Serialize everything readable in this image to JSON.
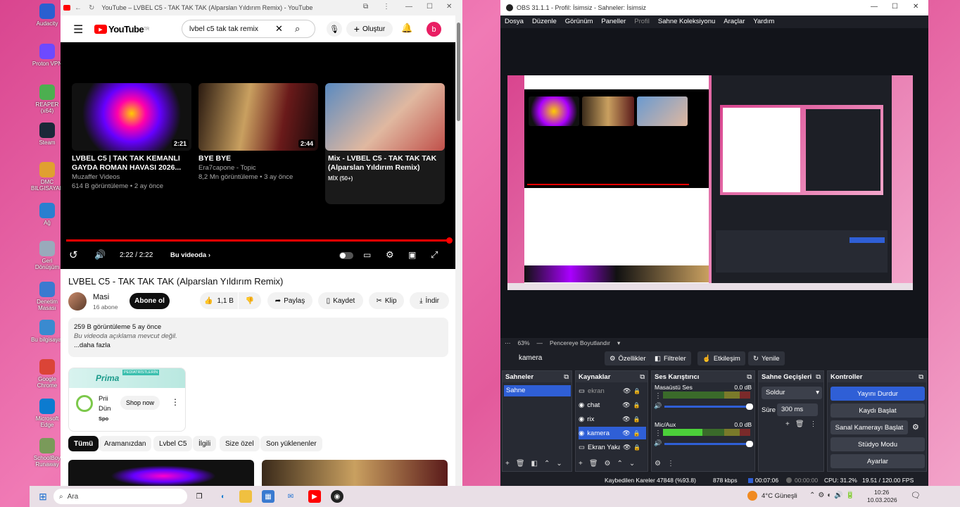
{
  "desktop": {
    "icons": [
      {
        "label": "Audacity",
        "color": "#2a5fd0"
      },
      {
        "label": "Proton VPN",
        "color": "#6d4aff"
      },
      {
        "label": "REAPER (x64)",
        "color": "#4caf50"
      },
      {
        "label": "Steam",
        "color": "#1b2838"
      },
      {
        "label": "DMC BILGISAYAR",
        "color": "#e0a030"
      },
      {
        "label": "Ağ",
        "color": "#2a7fd0"
      },
      {
        "label": "Geri Dönüşüm",
        "color": "#9ab"
      },
      {
        "label": "Denetim Masası",
        "color": "#3a7ad0"
      },
      {
        "label": "Bu bilgisayar",
        "color": "#3a8ad0"
      },
      {
        "label": "Google Chrome",
        "color": "#db4437"
      },
      {
        "label": "Microsoft Edge",
        "color": "#0c7bd0"
      },
      {
        "label": "SchoolBoy Runaway",
        "color": "#7a9a5a"
      }
    ]
  },
  "browser": {
    "tab_title": "YouTube – LVBEL C5 - TAK TAK TAK (Alparslan Yıldırım Remix) - YouTube",
    "logo": "YouTube",
    "logo_sup": "TR",
    "search_value": "lvbel c5 tak tak remix",
    "create_label": "Oluştur",
    "avatar_letter": "b",
    "cards": [
      {
        "title": "LVBEL C5 | TAK TAK KEMANLI GAYDA ROMAN HAVASI 2026...",
        "channel": "Muzaffer Videos",
        "meta": "614 B görüntüleme • 2 ay önce",
        "duration": "2:21"
      },
      {
        "title": "BYE BYE",
        "channel": "Era7capone - Topic",
        "meta": "8,2 Mn görüntüleme • 3 ay önce",
        "duration": "2:44"
      },
      {
        "title": "Mix - LVBEL C5 - TAK TAK TAK (Alparslan Yıldırım Remix)",
        "channel": "",
        "meta": "MİX (50+)",
        "duration": ""
      }
    ],
    "player": {
      "time": "2:22 / 2:22",
      "in_video": "Bu videoda",
      "progress": 1.0
    },
    "video_title": "LVBEL C5 - TAK TAK TAK (Alparslan Yıldırım Remix)",
    "channel_name": "Masi",
    "subscribers": "16 abone",
    "subscribe_label": "Abone ol",
    "likes": "1,1 B",
    "share_label": "Paylaş",
    "save_label": "Kaydet",
    "clip_label": "Klip",
    "download_label": "İndir",
    "desc_stats": "259 B görüntüleme  5 ay önce",
    "desc_text": "Bu videoda açıklama mevcut değil.",
    "desc_more": "...daha fazla",
    "ad": {
      "brand": "Prima",
      "banner": "PEDİATRİSTLERİN",
      "title": "Prii",
      "subtitle": "Dün",
      "sponsored": "Spo",
      "shop_label": "Shop now"
    },
    "chips": [
      "Tümü",
      "Aramanızdan",
      "Lvbel C5",
      "İlgili",
      "Size özel",
      "Son yüklenenler"
    ]
  },
  "obs": {
    "title": "OBS 31.1.1 - Profil: İsimsiz - Sahneler: İsimsiz",
    "menu": [
      "Dosya",
      "Düzenle",
      "Görünüm",
      "Paneller",
      "Profil",
      "Sahne Koleksiyonu",
      "Araçlar",
      "Yardım"
    ],
    "zoom": "63%",
    "fit_label": "Pencereye Boyutlandır",
    "source_name": "kamera",
    "toolbar": [
      "Özellikler",
      "Filtreler",
      "Etkileşim",
      "Yenile"
    ],
    "scenes_title": "Sahneler",
    "scenes": [
      "Sahne"
    ],
    "sources_title": "Kaynaklar",
    "sources": [
      "ekran",
      "chat",
      "rix",
      "kamera",
      "Ekran Yaka"
    ],
    "mixer_title": "Ses Karıştırıcı",
    "mixer": [
      {
        "name": "Masaüstü Ses",
        "db": "0.0 dB"
      },
      {
        "name": "Mic/Aux",
        "db": "0.0 dB"
      }
    ],
    "transitions_title": "Sahne Geçişleri",
    "transition_value": "Soldur",
    "duration_label": "Süre",
    "duration_value": "300 ms",
    "controls_title": "Kontroller",
    "controls": [
      "Yayını Durdur",
      "Kaydı Başlat",
      "Sanal Kamerayı Başlat",
      "Stüdyo Modu",
      "Ayarlar"
    ],
    "status": {
      "dropped": "Kaybedilen Kareler 47848 (%93.8)",
      "bitrate": "878 kbps",
      "stream_time": "00:07:06",
      "rec_time": "00:00:00",
      "cpu": "CPU: 31.2%",
      "fps": "19.51 / 120.00 FPS"
    }
  },
  "taskbar": {
    "search_placeholder": "Ara",
    "weather": "4°C  Güneşli",
    "time": "10:26",
    "date": "10.03.2026"
  },
  "colors": {
    "yt_red": "#ff0000",
    "obs_accent": "#2f5fd6",
    "pink": "#e35a9c"
  }
}
